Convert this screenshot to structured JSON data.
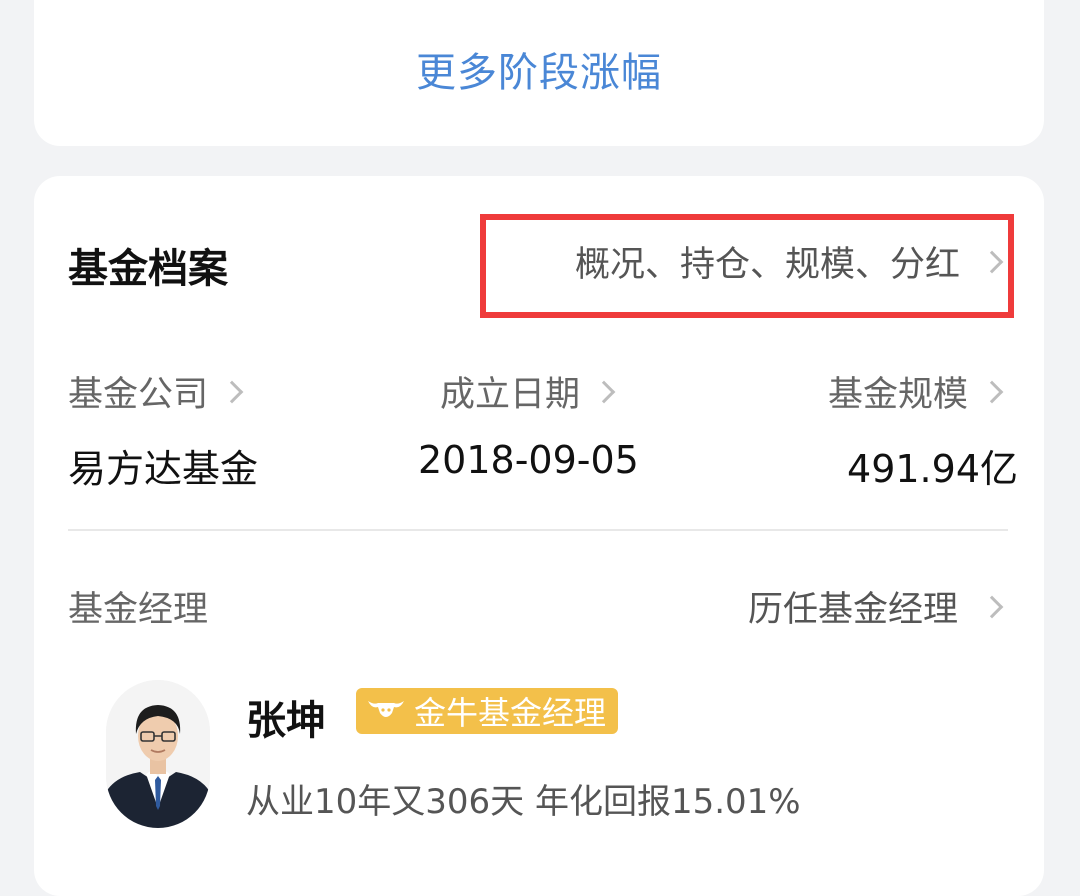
{
  "top_card": {
    "more_link": "更多阶段涨幅"
  },
  "profile": {
    "title": "基金档案",
    "header_link": "概况、持仓、规模、分红",
    "info": [
      {
        "label": "基金公司",
        "value": "易方达基金"
      },
      {
        "label": "成立日期",
        "value": "2018-09-05"
      },
      {
        "label": "基金规模",
        "value": "491.94亿"
      }
    ]
  },
  "manager": {
    "section_label": "基金经理",
    "history_link": "历任基金经理",
    "name": "张坤",
    "badge": "金牛基金经理",
    "stats": "从业10年又306天 年化回报15.01%"
  },
  "colors": {
    "link_blue": "#4a87d6",
    "highlight_red": "#ef3b3b",
    "badge_gold": "#f3c04a"
  },
  "icons": [
    "chevron-right-icon",
    "bull-icon",
    "avatar-photo"
  ]
}
